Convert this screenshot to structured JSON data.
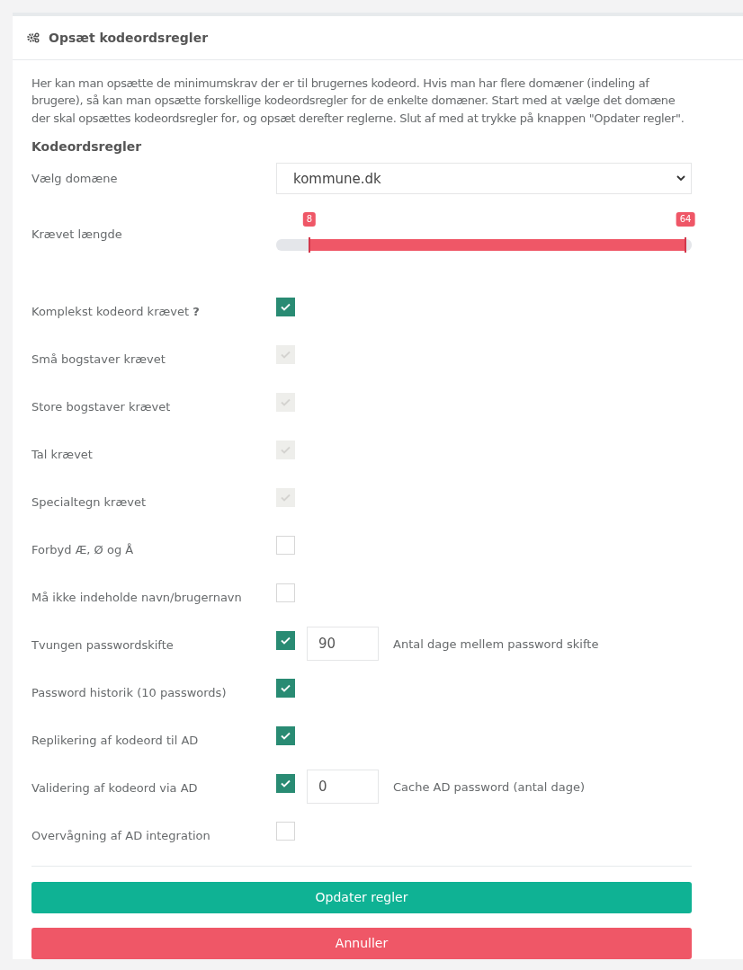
{
  "panel": {
    "title": "Opsæt kodeordsregler"
  },
  "intro": "Her kan man opsætte de minimumskrav der er til brugernes kodeord. Hvis man har flere domæner (indeling af brugere), så kan man opsætte forskellige kodeordsregler for de enkelte domæner. Start med at vælge det domæne der skal opsættes kodeordsregler for, og opsæt derefter reglerne. Slut af med at trykke på knappen \"Opdater regler\".",
  "section_heading": "Kodeordsregler",
  "domain": {
    "label": "Vælg domæne",
    "value": "kommune.dk"
  },
  "length": {
    "label": "Krævet længde",
    "handles": [
      {
        "label": "8",
        "level": 0.08
      },
      {
        "label": "64",
        "level": 0.985
      }
    ]
  },
  "rules": [
    {
      "label": "Komplekst kodeord krævet **?**",
      "checked": true,
      "disabled": false
    },
    {
      "label": "Små bogstaver krævet",
      "checked": true,
      "disabled": true
    },
    {
      "label": "Store bogstaver krævet",
      "checked": true,
      "disabled": true
    },
    {
      "label": "Tal krævet",
      "checked": true,
      "disabled": true
    },
    {
      "label": "Specialtegn krævet",
      "checked": true,
      "disabled": true
    },
    {
      "label": "Forbyd Æ, Ø og Å",
      "checked": false,
      "disabled": false
    },
    {
      "label": "Må ikke indeholde navn/brugernavn",
      "checked": false,
      "disabled": false
    },
    {
      "label": "Tvungen passwordskifte",
      "checked": true,
      "disabled": false,
      "input": {
        "value": "90",
        "hint": "Antal dage mellem password skifte"
      }
    },
    {
      "label": "Password historik (10 passwords)",
      "checked": true,
      "disabled": false
    },
    {
      "label": "Replikering af kodeord til AD",
      "checked": true,
      "disabled": false
    },
    {
      "label": "Validering af kodeord via AD",
      "checked": true,
      "disabled": false,
      "input": {
        "value": "0",
        "hint": "Cache AD password (antal dage)"
      }
    },
    {
      "label": "Overvågning af AD integration",
      "checked": false,
      "disabled": false
    }
  ],
  "buttons": [
    {
      "label": "Opdater regler",
      "kind": "primary"
    },
    {
      "label": "Annuller",
      "kind": "danger"
    }
  ]
}
